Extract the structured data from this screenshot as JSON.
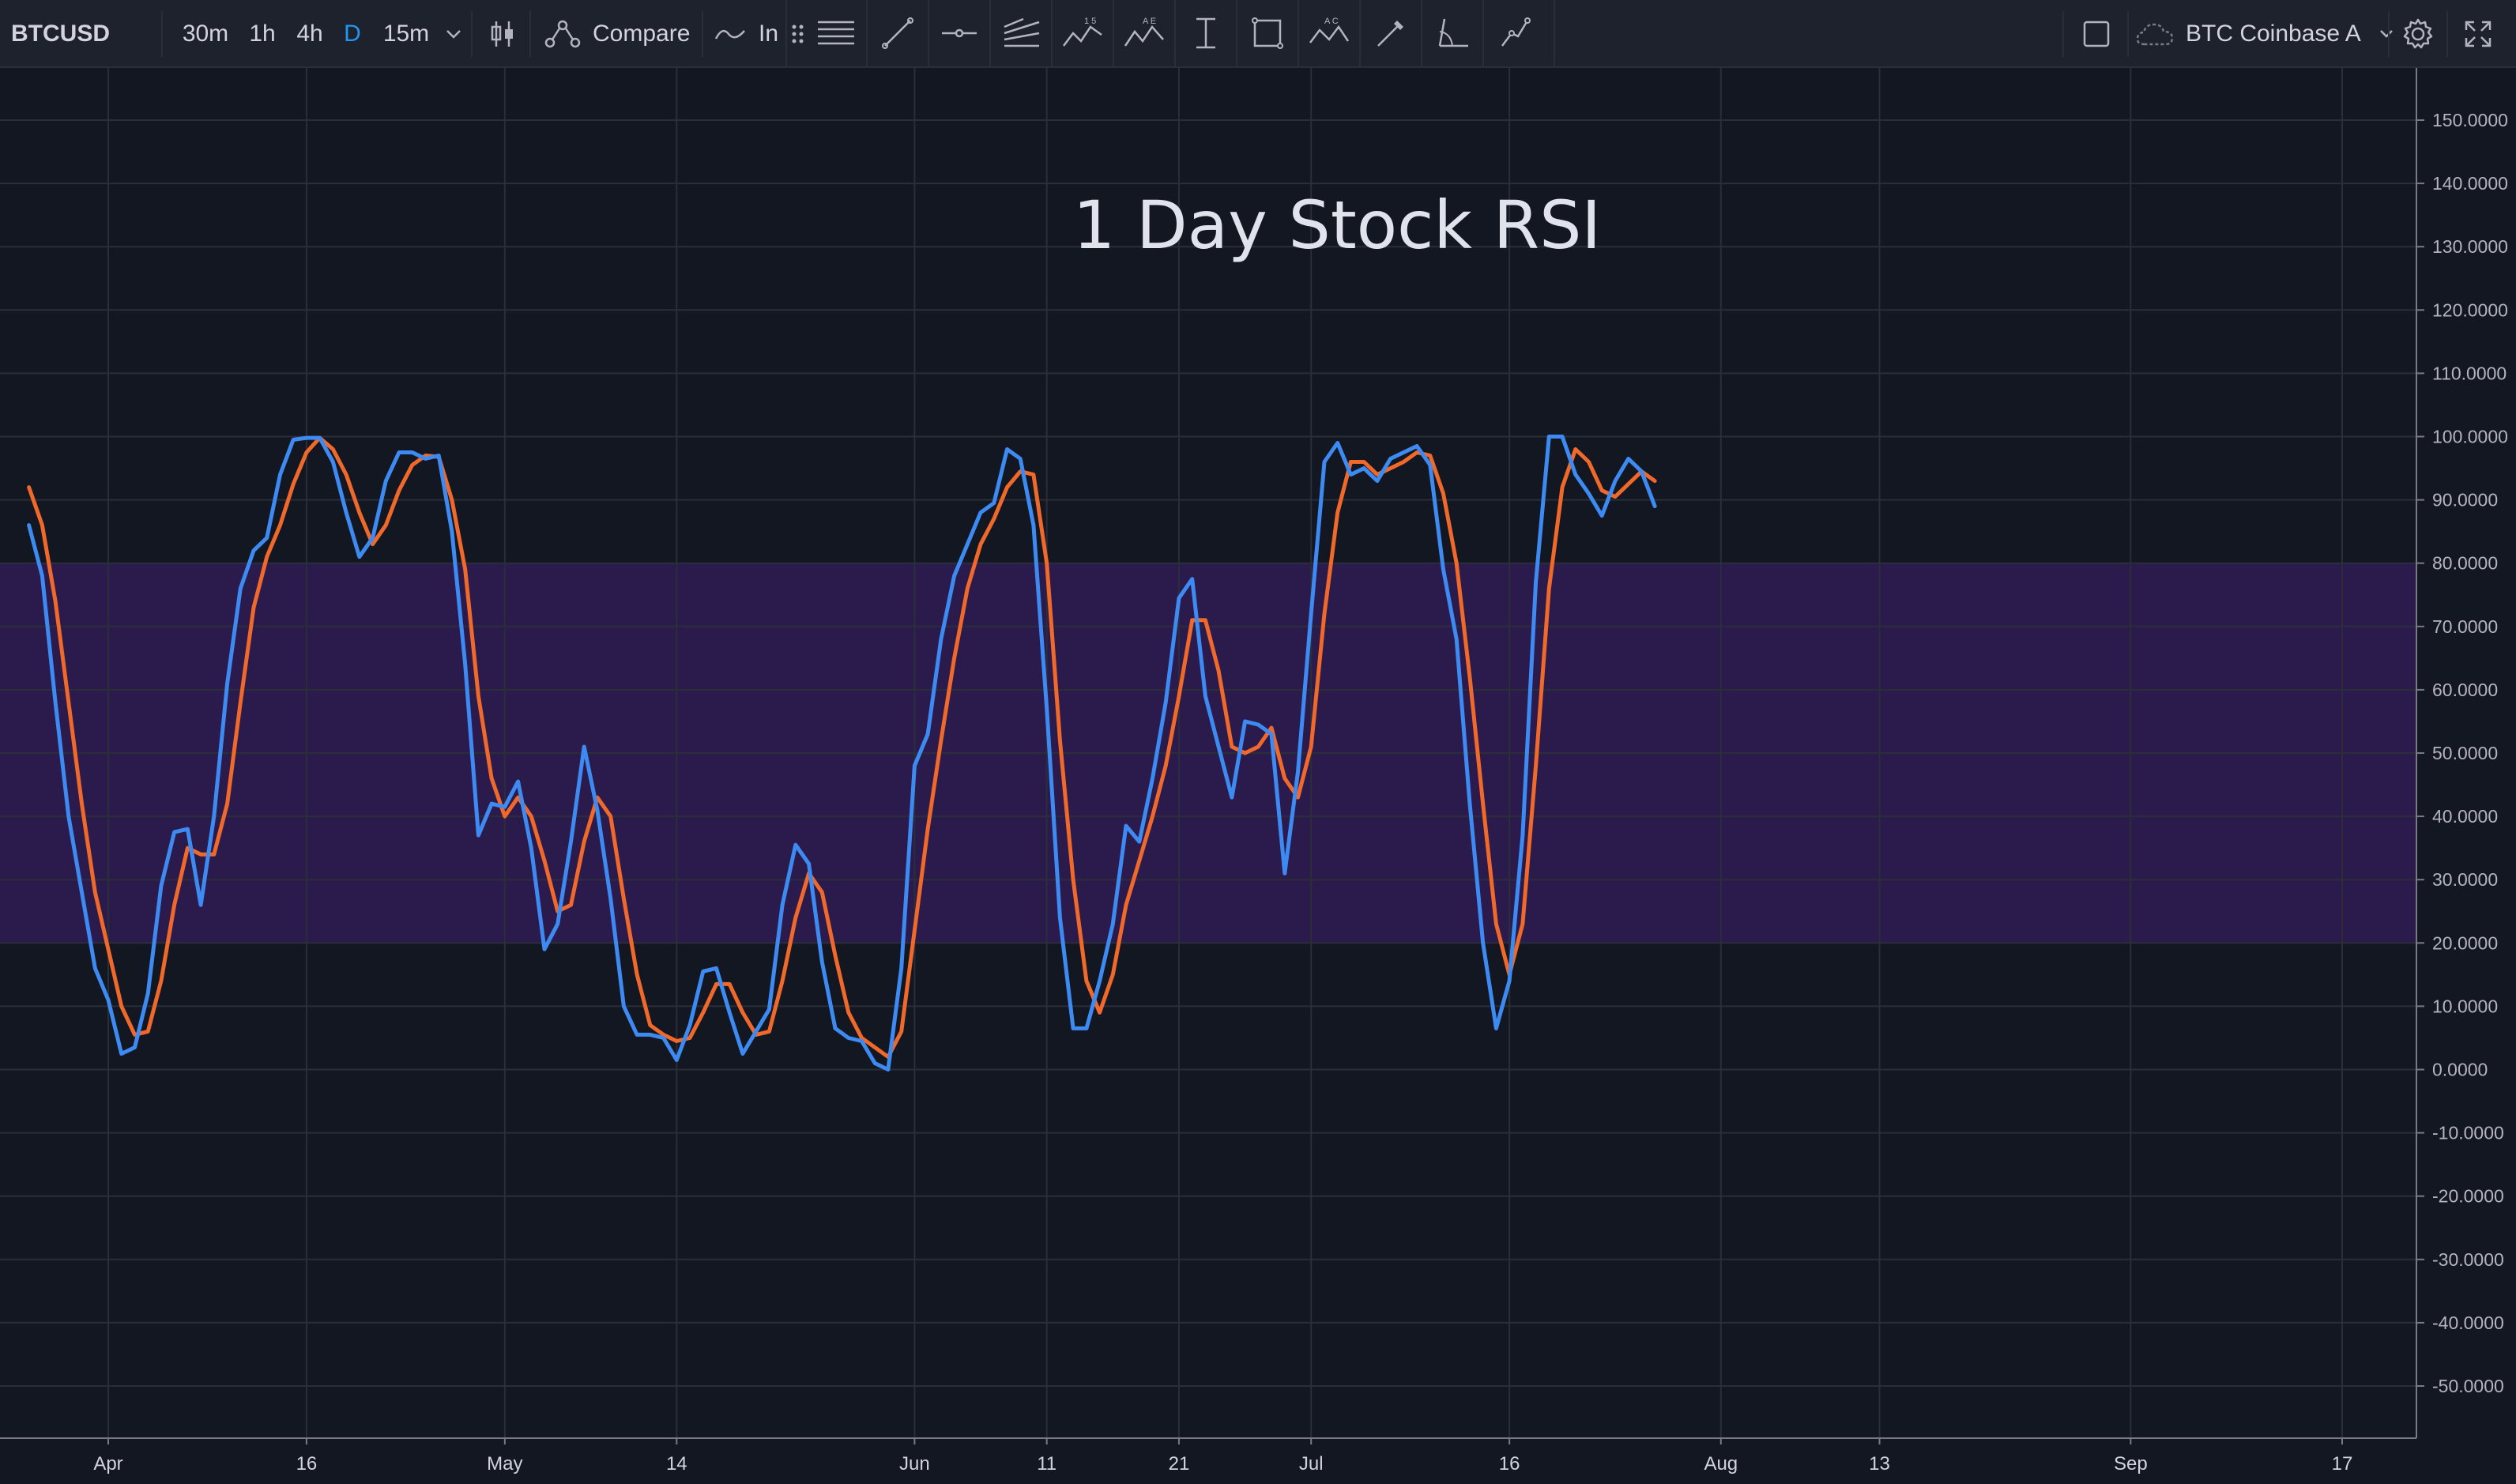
{
  "toolbar": {
    "symbol": "BTCUSD",
    "intervals": [
      "30m",
      "1h",
      "4h",
      "D",
      "15m"
    ],
    "active_interval": "D",
    "compare_label": "Compare",
    "indicators_label": "In",
    "datasource_label": "BTC Coinbase A"
  },
  "icons": {
    "interval_dropdown": "chevron-down-icon",
    "chart_type": "candlestick-icon",
    "compare": "compare-icon",
    "indicators": "indicator-wave-icon",
    "drag_handle": "drag-handle-icon",
    "drawing_tools": [
      "horizontal-lines-icon",
      "trend-line-icon",
      "horizontal-ray-icon",
      "pitchfork-icon",
      "pattern-15-icon",
      "pattern-ae-icon",
      "text-cursor-icon",
      "rectangle-icon",
      "pattern-ac-icon",
      "brush-icon",
      "angle-icon",
      "path-icon"
    ],
    "layout": "square-icon",
    "datasource": "cloud-icon",
    "settings": "gear-icon",
    "fullscreen": "fullscreen-icon"
  },
  "colors": {
    "background": "#131722",
    "toolbar": "#1e222d",
    "k_line": "#3d8bf2",
    "d_line": "#f0692a",
    "band_fill": "#2b1b4d",
    "active": "#2196f3"
  },
  "chart_data": {
    "type": "line",
    "title": "1 Day Stock RSI",
    "xlabel": "",
    "ylabel": "",
    "ylim": [
      -55,
      155
    ],
    "y_ticks": [
      "150.0000",
      "140.0000",
      "130.0000",
      "120.0000",
      "110.0000",
      "100.0000",
      "90.0000",
      "80.0000",
      "70.0000",
      "60.0000",
      "50.0000",
      "40.0000",
      "30.0000",
      "20.0000",
      "10.0000",
      "0.0000",
      "-10.0000",
      "-20.0000",
      "-30.0000",
      "-40.0000",
      "-50.0000"
    ],
    "y_tick_values": [
      150,
      140,
      130,
      120,
      110,
      100,
      90,
      80,
      70,
      60,
      50,
      40,
      30,
      20,
      10,
      0,
      -10,
      -20,
      -30,
      -40,
      -50
    ],
    "x_ticks": [
      "Apr",
      "16",
      "May",
      "14",
      "Jun",
      "11",
      "21",
      "Jul",
      "16",
      "Aug",
      "13",
      "Sep",
      "17"
    ],
    "x_tick_dates": [
      "2018-04-01",
      "2018-04-16",
      "2018-05-01",
      "2018-05-14",
      "2018-06-01",
      "2018-06-11",
      "2018-06-21",
      "2018-07-01",
      "2018-07-16",
      "2018-08-01",
      "2018-08-13",
      "2018-09-01",
      "2018-09-17"
    ],
    "x_range": [
      "2018-03-26",
      "2018-09-23"
    ],
    "band": {
      "lower": 20,
      "upper": 80
    },
    "grid": true,
    "legend": "none",
    "series": [
      {
        "color": "#3d8bf2",
        "points": [
          [
            "2018-03-26",
            86
          ],
          [
            "2018-03-27",
            78
          ],
          [
            "2018-03-28",
            58
          ],
          [
            "2018-03-29",
            40
          ],
          [
            "2018-03-30",
            28
          ],
          [
            "2018-03-31",
            16
          ],
          [
            "2018-04-01",
            11
          ],
          [
            "2018-04-02",
            2.5
          ],
          [
            "2018-04-03",
            3.5
          ],
          [
            "2018-04-04",
            12
          ],
          [
            "2018-04-05",
            29
          ],
          [
            "2018-04-06",
            37.5
          ],
          [
            "2018-04-07",
            38
          ],
          [
            "2018-04-08",
            26
          ],
          [
            "2018-04-09",
            40
          ],
          [
            "2018-04-10",
            61
          ],
          [
            "2018-04-11",
            76
          ],
          [
            "2018-04-12",
            82
          ],
          [
            "2018-04-13",
            84
          ],
          [
            "2018-04-14",
            94
          ],
          [
            "2018-04-15",
            99.5
          ],
          [
            "2018-04-16",
            99.8
          ],
          [
            "2018-04-17",
            99.8
          ],
          [
            "2018-04-18",
            96
          ],
          [
            "2018-04-19",
            88
          ],
          [
            "2018-04-20",
            81
          ],
          [
            "2018-04-21",
            84
          ],
          [
            "2018-04-22",
            93
          ],
          [
            "2018-04-23",
            97.5
          ],
          [
            "2018-04-24",
            97.5
          ],
          [
            "2018-04-25",
            96.5
          ],
          [
            "2018-04-26",
            97
          ],
          [
            "2018-04-27",
            85
          ],
          [
            "2018-04-28",
            64
          ],
          [
            "2018-04-29",
            37
          ],
          [
            "2018-04-30",
            42
          ],
          [
            "2018-05-01",
            41.5
          ],
          [
            "2018-05-02",
            45.5
          ],
          [
            "2018-05-03",
            35
          ],
          [
            "2018-05-04",
            19
          ],
          [
            "2018-05-05",
            23
          ],
          [
            "2018-05-06",
            36
          ],
          [
            "2018-05-07",
            51
          ],
          [
            "2018-05-08",
            41
          ],
          [
            "2018-05-09",
            27
          ],
          [
            "2018-05-10",
            10
          ],
          [
            "2018-05-11",
            5.5
          ],
          [
            "2018-05-12",
            5.5
          ],
          [
            "2018-05-13",
            5
          ],
          [
            "2018-05-14",
            1.5
          ],
          [
            "2018-05-15",
            7
          ],
          [
            "2018-05-16",
            15.5
          ],
          [
            "2018-05-17",
            16
          ],
          [
            "2018-05-18",
            9
          ],
          [
            "2018-05-19",
            2.5
          ],
          [
            "2018-05-20",
            6
          ],
          [
            "2018-05-21",
            9.5
          ],
          [
            "2018-05-22",
            26
          ],
          [
            "2018-05-23",
            35.5
          ],
          [
            "2018-05-24",
            32.5
          ],
          [
            "2018-05-25",
            17
          ],
          [
            "2018-05-26",
            6.5
          ],
          [
            "2018-05-27",
            5
          ],
          [
            "2018-05-28",
            4.5
          ],
          [
            "2018-05-29",
            1
          ],
          [
            "2018-05-30",
            0
          ],
          [
            "2018-05-31",
            16
          ],
          [
            "2018-06-01",
            48
          ],
          [
            "2018-06-02",
            53
          ],
          [
            "2018-06-03",
            68
          ],
          [
            "2018-06-04",
            78
          ],
          [
            "2018-06-05",
            83
          ],
          [
            "2018-06-06",
            88
          ],
          [
            "2018-06-07",
            89.5
          ],
          [
            "2018-06-08",
            98
          ],
          [
            "2018-06-09",
            96.5
          ],
          [
            "2018-06-10",
            86
          ],
          [
            "2018-06-11",
            57
          ],
          [
            "2018-06-12",
            24
          ],
          [
            "2018-06-13",
            6.5
          ],
          [
            "2018-06-14",
            6.5
          ],
          [
            "2018-06-15",
            14
          ],
          [
            "2018-06-16",
            23
          ],
          [
            "2018-06-17",
            38.5
          ],
          [
            "2018-06-18",
            36
          ],
          [
            "2018-06-19",
            46
          ],
          [
            "2018-06-20",
            58
          ],
          [
            "2018-06-21",
            74.5
          ],
          [
            "2018-06-22",
            77.5
          ],
          [
            "2018-06-23",
            59
          ],
          [
            "2018-06-24",
            51
          ],
          [
            "2018-06-25",
            43
          ],
          [
            "2018-06-26",
            55
          ],
          [
            "2018-06-27",
            54.5
          ],
          [
            "2018-06-28",
            53
          ],
          [
            "2018-06-29",
            31
          ],
          [
            "2018-06-30",
            47
          ],
          [
            "2018-07-01",
            72
          ],
          [
            "2018-07-02",
            96
          ],
          [
            "2018-07-03",
            99
          ],
          [
            "2018-07-04",
            94
          ],
          [
            "2018-07-05",
            95
          ],
          [
            "2018-07-06",
            93
          ],
          [
            "2018-07-07",
            96.5
          ],
          [
            "2018-07-08",
            97.5
          ],
          [
            "2018-07-09",
            98.5
          ],
          [
            "2018-07-10",
            95.5
          ],
          [
            "2018-07-11",
            79
          ],
          [
            "2018-07-12",
            68
          ],
          [
            "2018-07-13",
            42
          ],
          [
            "2018-07-14",
            20
          ],
          [
            "2018-07-15",
            6.5
          ],
          [
            "2018-07-16",
            14
          ],
          [
            "2018-07-17",
            37
          ],
          [
            "2018-07-18",
            77
          ],
          [
            "2018-07-19",
            100
          ],
          [
            "2018-07-20",
            100
          ],
          [
            "2018-07-21",
            94
          ],
          [
            "2018-07-22",
            91
          ],
          [
            "2018-07-23",
            87.5
          ],
          [
            "2018-07-24",
            93
          ],
          [
            "2018-07-25",
            96.5
          ],
          [
            "2018-07-26",
            94.5
          ],
          [
            "2018-07-27",
            89
          ]
        ]
      },
      {
        "color": "#f0692a",
        "points": [
          [
            "2018-03-26",
            92
          ],
          [
            "2018-03-27",
            86
          ],
          [
            "2018-03-28",
            74
          ],
          [
            "2018-03-29",
            58
          ],
          [
            "2018-03-30",
            42
          ],
          [
            "2018-03-31",
            28
          ],
          [
            "2018-04-01",
            19
          ],
          [
            "2018-04-02",
            10
          ],
          [
            "2018-04-03",
            5.5
          ],
          [
            "2018-04-04",
            6
          ],
          [
            "2018-04-05",
            14
          ],
          [
            "2018-04-06",
            26
          ],
          [
            "2018-04-07",
            35
          ],
          [
            "2018-04-08",
            34
          ],
          [
            "2018-04-09",
            34
          ],
          [
            "2018-04-10",
            42
          ],
          [
            "2018-04-11",
            58
          ],
          [
            "2018-04-12",
            73
          ],
          [
            "2018-04-13",
            81
          ],
          [
            "2018-04-14",
            86
          ],
          [
            "2018-04-15",
            92.5
          ],
          [
            "2018-04-16",
            97.5
          ],
          [
            "2018-04-17",
            99.8
          ],
          [
            "2018-04-18",
            98
          ],
          [
            "2018-04-19",
            94
          ],
          [
            "2018-04-20",
            88
          ],
          [
            "2018-04-21",
            83
          ],
          [
            "2018-04-22",
            86
          ],
          [
            "2018-04-23",
            91.5
          ],
          [
            "2018-04-24",
            95.5
          ],
          [
            "2018-04-25",
            97
          ],
          [
            "2018-04-26",
            96.8
          ],
          [
            "2018-04-27",
            90
          ],
          [
            "2018-04-28",
            79
          ],
          [
            "2018-04-29",
            59
          ],
          [
            "2018-04-30",
            46
          ],
          [
            "2018-05-01",
            40
          ],
          [
            "2018-05-02",
            43
          ],
          [
            "2018-05-03",
            40
          ],
          [
            "2018-05-04",
            33
          ],
          [
            "2018-05-05",
            25
          ],
          [
            "2018-05-06",
            26
          ],
          [
            "2018-05-07",
            36
          ],
          [
            "2018-05-08",
            43
          ],
          [
            "2018-05-09",
            40
          ],
          [
            "2018-05-10",
            27
          ],
          [
            "2018-05-11",
            15
          ],
          [
            "2018-05-12",
            7
          ],
          [
            "2018-05-13",
            5.5
          ],
          [
            "2018-05-14",
            4.5
          ],
          [
            "2018-05-15",
            5
          ],
          [
            "2018-05-16",
            9
          ],
          [
            "2018-05-17",
            13.5
          ],
          [
            "2018-05-18",
            13.5
          ],
          [
            "2018-05-19",
            9
          ],
          [
            "2018-05-20",
            5.5
          ],
          [
            "2018-05-21",
            6
          ],
          [
            "2018-05-22",
            14
          ],
          [
            "2018-05-23",
            24
          ],
          [
            "2018-05-24",
            31
          ],
          [
            "2018-05-25",
            28
          ],
          [
            "2018-05-26",
            18
          ],
          [
            "2018-05-27",
            9
          ],
          [
            "2018-05-28",
            5
          ],
          [
            "2018-05-29",
            3.5
          ],
          [
            "2018-05-30",
            2
          ],
          [
            "2018-05-31",
            6
          ],
          [
            "2018-06-01",
            22
          ],
          [
            "2018-06-02",
            38
          ],
          [
            "2018-06-03",
            52
          ],
          [
            "2018-06-04",
            65
          ],
          [
            "2018-06-05",
            76
          ],
          [
            "2018-06-06",
            83
          ],
          [
            "2018-06-07",
            87
          ],
          [
            "2018-06-08",
            92
          ],
          [
            "2018-06-09",
            94.5
          ],
          [
            "2018-06-10",
            94
          ],
          [
            "2018-06-11",
            80
          ],
          [
            "2018-06-12",
            52
          ],
          [
            "2018-06-13",
            30
          ],
          [
            "2018-06-14",
            14
          ],
          [
            "2018-06-15",
            9
          ],
          [
            "2018-06-16",
            15
          ],
          [
            "2018-06-17",
            26
          ],
          [
            "2018-06-18",
            33
          ],
          [
            "2018-06-19",
            40
          ],
          [
            "2018-06-20",
            48
          ],
          [
            "2018-06-21",
            59
          ],
          [
            "2018-06-22",
            71
          ],
          [
            "2018-06-23",
            71
          ],
          [
            "2018-06-24",
            63
          ],
          [
            "2018-06-25",
            51
          ],
          [
            "2018-06-26",
            50
          ],
          [
            "2018-06-27",
            51
          ],
          [
            "2018-06-28",
            54
          ],
          [
            "2018-06-29",
            46
          ],
          [
            "2018-06-30",
            43
          ],
          [
            "2018-07-01",
            51
          ],
          [
            "2018-07-02",
            72
          ],
          [
            "2018-07-03",
            88
          ],
          [
            "2018-07-04",
            96
          ],
          [
            "2018-07-05",
            96
          ],
          [
            "2018-07-06",
            94
          ],
          [
            "2018-07-07",
            95
          ],
          [
            "2018-07-08",
            96
          ],
          [
            "2018-07-09",
            97.5
          ],
          [
            "2018-07-10",
            97
          ],
          [
            "2018-07-11",
            91
          ],
          [
            "2018-07-12",
            80
          ],
          [
            "2018-07-13",
            62
          ],
          [
            "2018-07-14",
            42
          ],
          [
            "2018-07-15",
            23
          ],
          [
            "2018-07-16",
            15
          ],
          [
            "2018-07-17",
            23
          ],
          [
            "2018-07-18",
            48
          ],
          [
            "2018-07-19",
            76
          ],
          [
            "2018-07-20",
            92
          ],
          [
            "2018-07-21",
            98
          ],
          [
            "2018-07-22",
            96
          ],
          [
            "2018-07-23",
            91.5
          ],
          [
            "2018-07-24",
            90.5
          ],
          [
            "2018-07-25",
            92.5
          ],
          [
            "2018-07-26",
            94.5
          ],
          [
            "2018-07-27",
            93
          ]
        ]
      }
    ]
  }
}
